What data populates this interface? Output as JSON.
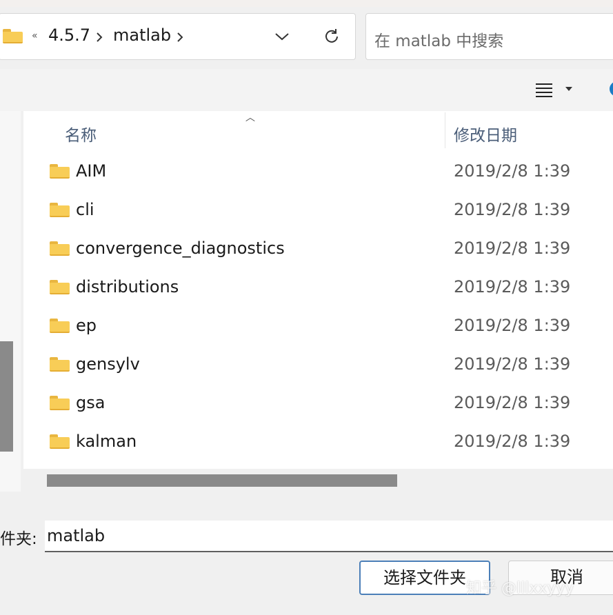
{
  "address_bar": {
    "overflow_chevron": "«",
    "breadcrumbs": [
      "4.5.7",
      "matlab"
    ],
    "separator": ">"
  },
  "search": {
    "placeholder": "在 matlab 中搜索"
  },
  "columns": {
    "name": "名称",
    "date_modified": "修改日期"
  },
  "files": [
    {
      "name": "AIM",
      "date": "2019/2/8 1:39"
    },
    {
      "name": "cli",
      "date": "2019/2/8 1:39"
    },
    {
      "name": "convergence_diagnostics",
      "date": "2019/2/8 1:39"
    },
    {
      "name": "distributions",
      "date": "2019/2/8 1:39"
    },
    {
      "name": "ep",
      "date": "2019/2/8 1:39"
    },
    {
      "name": "gensylv",
      "date": "2019/2/8 1:39"
    },
    {
      "name": "gsa",
      "date": "2019/2/8 1:39"
    },
    {
      "name": "kalman",
      "date": "2019/2/8 1:39"
    }
  ],
  "folder_field": {
    "label": "件夹:",
    "value": "matlab"
  },
  "buttons": {
    "select": "选择文件夹",
    "cancel": "取消"
  },
  "watermark": "知乎 @lllxxyyy",
  "icons": {
    "folder": "folder-icon",
    "dropdown": "chevron-down-icon",
    "refresh": "refresh-icon",
    "view": "list-view-icon"
  }
}
